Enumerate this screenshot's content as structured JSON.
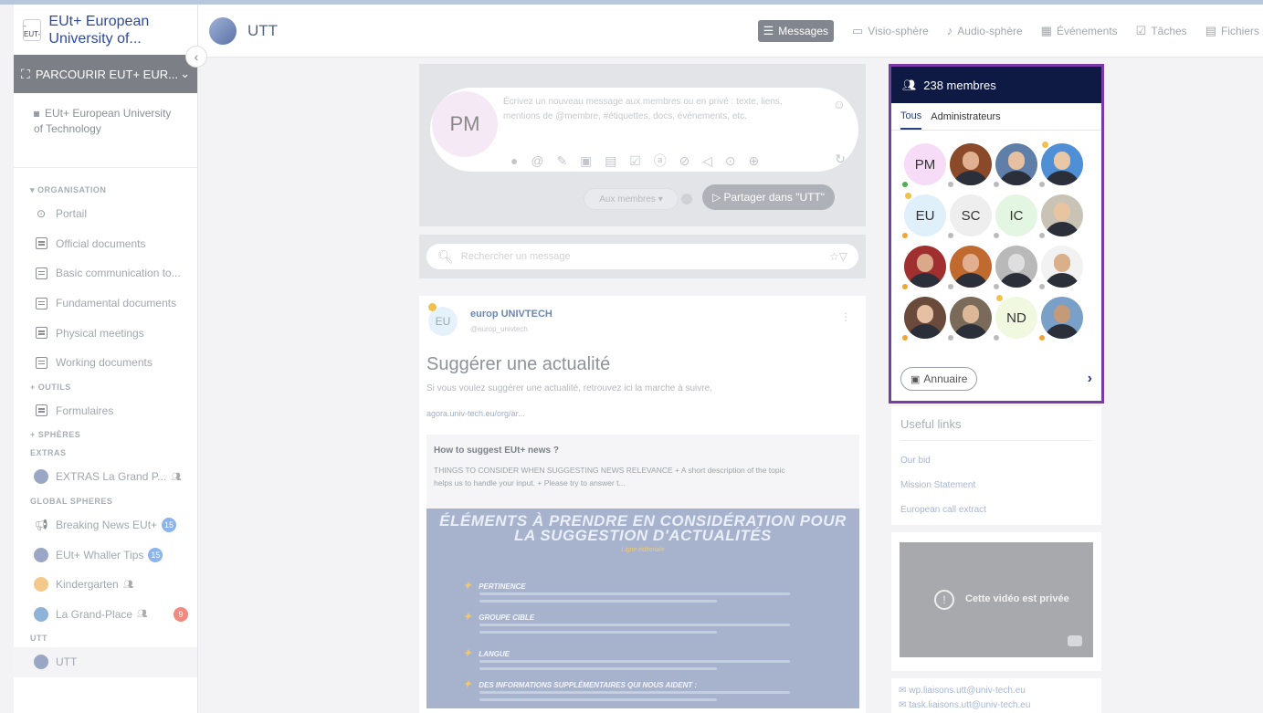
{
  "org": {
    "logo_text": "-EUT-",
    "name": "EUt+ European University of...",
    "browse_label": "PARCOURIR EUT+ EUR...",
    "current_item": "EUt+ European University of Technology"
  },
  "sidebar": {
    "sections": {
      "organisation": "ORGANISATION",
      "outils": "OUTILS",
      "spheres": "SPHÈRES",
      "extras": "EXTRAS",
      "global_spheres": "GLOBAL SPHERES",
      "utt": "UTT"
    },
    "organisation_items": [
      {
        "label": "Portail",
        "icon": "portal-icon"
      },
      {
        "label": "Official documents",
        "icon": "document-icon"
      },
      {
        "label": "Basic communication to...",
        "icon": "document-icon"
      },
      {
        "label": "Fundamental documents",
        "icon": "document-icon"
      },
      {
        "label": "Physical meetings",
        "icon": "document-icon"
      },
      {
        "label": "Working documents",
        "icon": "document-icon"
      }
    ],
    "outils_items": [
      {
        "label": "Formulaires",
        "icon": "form-icon"
      }
    ],
    "extras_items": [
      {
        "label": "EXTRAS La Grand P...",
        "icon": "sphere-icon"
      }
    ],
    "global_items": [
      {
        "label": "Breaking News EUt+",
        "badge": "15"
      },
      {
        "label": "EUt+ Whaller Tips",
        "badge": "15"
      },
      {
        "label": "Kindergarten"
      },
      {
        "label": "La Grand-Place",
        "badge": "9"
      }
    ],
    "utt_items": [
      {
        "label": "UTT"
      }
    ],
    "collapse_glyph": "‹"
  },
  "topbar": {
    "sphere_name": "UTT",
    "tabs": [
      {
        "label": "Messages",
        "icon": "messages-icon",
        "glyph": "☰",
        "active": true
      },
      {
        "label": "Visio-sphère",
        "icon": "video-icon",
        "glyph": "▭"
      },
      {
        "label": "Audio-sphère",
        "icon": "microphone-icon",
        "glyph": "♪"
      },
      {
        "label": "Événements",
        "icon": "calendar-icon",
        "glyph": "▦"
      },
      {
        "label": "Tâches",
        "icon": "tasks-icon",
        "glyph": "☑"
      },
      {
        "label": "Fichiers",
        "icon": "files-icon",
        "glyph": "▤"
      }
    ]
  },
  "composer": {
    "avatar_initials": "PM",
    "placeholder": "Écrivez un nouveau message aux membres ou en privé : texte, liens, mentions de @membre, #étiquettes, docs, événements, etc.",
    "icons": "● @ ✎ ▣ ▤ ☑ ⓐ ⊘ ◁ ⊙ ⊕",
    "audience": "Aux membres ▾",
    "share_label": "Partager dans \"UTT\""
  },
  "search": {
    "placeholder": "Rechercher un message"
  },
  "post": {
    "avatar_initials": "EU",
    "author": "europ UNIVTECH",
    "handle": "@europ_univtech",
    "title": "Suggérer une actualité",
    "description": "Si vous voulez suggérer une actualité, retrouvez ici la marche à suivre.",
    "link": "agora.univ-tech.eu/org/ar...",
    "preview": {
      "title": "How to suggest EUt+ news ?",
      "description": "THINGS TO CONSIDER WHEN SUGGESTING NEWS   RELEVANCE + A short description of the topic helps us to handle your input. + Please try to answer t...",
      "image_title": "ÉLÉMENTS À PRENDRE EN CONSIDÉRATION POUR LA SUGGESTION D'ACTUALITÉS",
      "image_subtitle": "Ligne éditoriale",
      "image_items": [
        "PERTINENCE",
        "GROUPE CIBLE",
        "LANGUE",
        "DES INFORMATIONS SUPPLÉMENTAIRES QUI NOUS AIDENT :"
      ]
    }
  },
  "members": {
    "count_label": "238 membres",
    "tabs": [
      "Tous",
      "Administrateurs"
    ],
    "annuaire_label": "Annuaire",
    "avatars": [
      {
        "initials": "PM",
        "bg": "#f6dcf6",
        "dot": "#4caf50"
      },
      {
        "photo": true,
        "bg": "#8a4a2a",
        "skin": "#e0b090",
        "dot": "#bbbbbb"
      },
      {
        "photo": true,
        "bg": "#5f7fa8",
        "skin": "#e6c0a0",
        "dot": "#bbbbbb"
      },
      {
        "photo": true,
        "bg": "#4f8fd6",
        "skin": "#e9c8a8",
        "dot": "#bbbbbb",
        "star": true
      },
      {
        "initials": "EU",
        "bg": "#dff0fb",
        "dot": "#f1a534",
        "star": true
      },
      {
        "initials": "SC",
        "bg": "#eeeeee",
        "dot": "#bbbbbb"
      },
      {
        "initials": "IC",
        "bg": "#e3f6e1",
        "dot": "#bbbbbb"
      },
      {
        "photo": true,
        "bg": "#c9c3b6",
        "skin": "#e8c4a0",
        "dot": "#bbbbbb"
      },
      {
        "photo": true,
        "bg": "#a03030",
        "skin": "#d9a98a",
        "dot": "#f1a534"
      },
      {
        "photo": true,
        "bg": "#c06a30",
        "skin": "#e2b090",
        "dot": "#bbbbbb"
      },
      {
        "photo": true,
        "bg": "#b9b9b9",
        "skin": "#dedede",
        "dot": "#bbbbbb"
      },
      {
        "photo": true,
        "bg": "#f2f2f2",
        "skin": "#d9b08a",
        "dot": "#bbbbbb"
      },
      {
        "photo": true,
        "bg": "#6a4a3a",
        "skin": "#e6c0a2",
        "dot": "#f1a534"
      },
      {
        "photo": true,
        "bg": "#7a6a5a",
        "skin": "#dcb898",
        "dot": "#bbbbbb"
      },
      {
        "initials": "ND",
        "bg": "#f1f8e0",
        "dot": "#bbbbbb",
        "star": true
      },
      {
        "photo": true,
        "bg": "#7aa0c8",
        "skin": "#c49a78",
        "dot": "#f1a534"
      }
    ]
  },
  "links": {
    "title": "Useful links",
    "items": [
      "Our bid",
      "Mission Statement",
      "European call extract"
    ]
  },
  "video": {
    "message": "Cette vidéo est privée"
  },
  "emails": [
    "wp.liaisons.utt@univ-tech.eu",
    "task.liaisons.utt@univ-tech.eu"
  ]
}
